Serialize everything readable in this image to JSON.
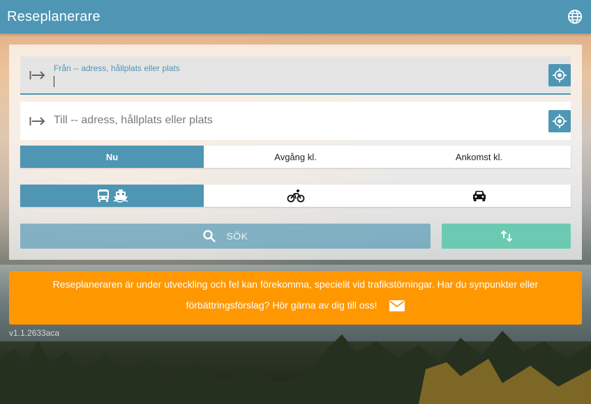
{
  "header": {
    "title": "Reseplanerare",
    "language_icon": "globe-icon"
  },
  "from_field": {
    "label": "Från -- adress, hållplats eller plats",
    "value": "",
    "icon": "arrow-right-bar-icon",
    "locate_icon": "my-location-icon"
  },
  "to_field": {
    "placeholder": "Till -- adress, hållplats eller plats",
    "value": "",
    "icon": "arrow-right-bar-icon",
    "locate_icon": "my-location-icon"
  },
  "time_options": {
    "now": "Nu",
    "depart": "Avgång kl.",
    "arrive": "Ankomst kl.",
    "selected": "Nu"
  },
  "mode_options": {
    "transit_icons": [
      "bus-icon",
      "ferry-icon"
    ],
    "bike_icon": "bicycle-icon",
    "car_icon": "car-icon",
    "selected": "transit"
  },
  "actions": {
    "search_label": "SÖK",
    "search_icon": "search-icon",
    "swap_icon": "swap-vertical-icon"
  },
  "banner": {
    "line1": "Reseplaneraren är under utveckling och fel kan förekomma, specielit vid trafikstörningar. Har du synpunkter eller",
    "line2": "förbättringsförslag? Hör gärna av dig till oss!",
    "mail_icon": "mail-icon"
  },
  "version": "v1.1.2633aca",
  "colors": {
    "primary": "#4e96b4",
    "swap": "#6dcab2",
    "banner": "#ff9800"
  }
}
